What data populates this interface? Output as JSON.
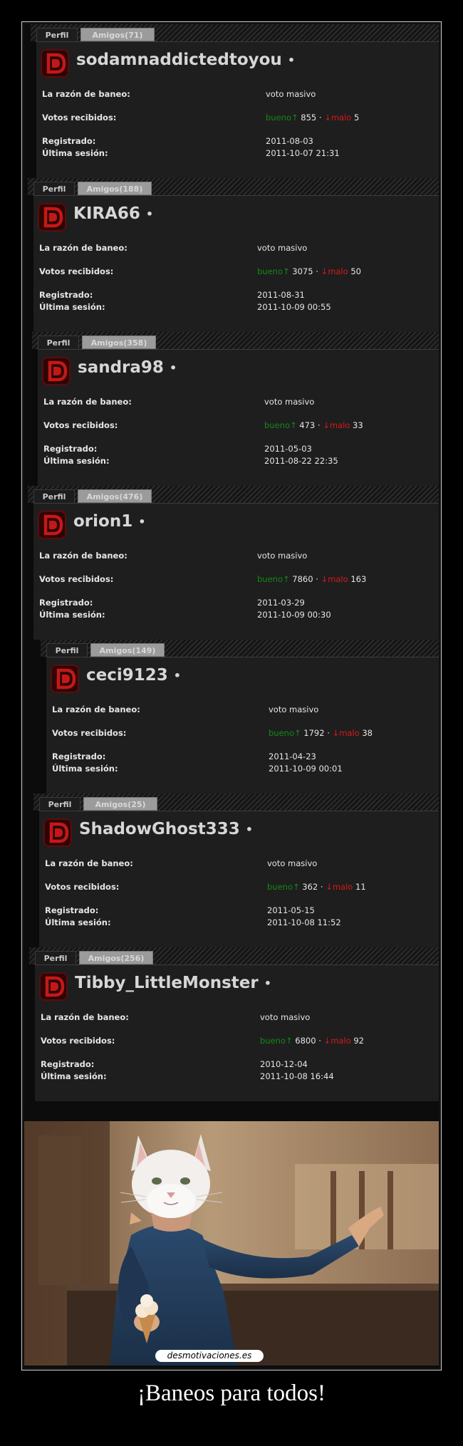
{
  "tabs": {
    "perfil": "Perfil"
  },
  "labels": {
    "reason": "La razón de baneo:",
    "votes": "Votos recibidos:",
    "registered": "Registrado:",
    "last_session": "Última sesión:"
  },
  "vote_words": {
    "good": "bueno",
    "bad": "malo"
  },
  "profiles": [
    {
      "username": "sodamnaddictedtoyou",
      "friends_tab": "Amigos(71)",
      "reason": "voto masivo",
      "good_votes": "855",
      "bad_votes": "5",
      "registered": "2011-08-03",
      "last_session": "2011-10-07 21:31"
    },
    {
      "username": "KIRA66",
      "friends_tab": "Amigos(188)",
      "reason": "voto masivo",
      "good_votes": "3075",
      "bad_votes": "50",
      "registered": "2011-08-31",
      "last_session": "2011-10-09 00:55"
    },
    {
      "username": "sandra98",
      "friends_tab": "Amigos(358)",
      "reason": "voto masivo",
      "good_votes": "473",
      "bad_votes": "33",
      "registered": "2011-05-03",
      "last_session": "2011-08-22 22:35"
    },
    {
      "username": "orion1",
      "friends_tab": "Amigos(476)",
      "reason": "voto masivo",
      "good_votes": "7860",
      "bad_votes": "163",
      "registered": "2011-03-29",
      "last_session": "2011-10-09 00:30"
    },
    {
      "username": "ceci9123",
      "friends_tab": "Amigos(149)",
      "reason": "voto masivo",
      "good_votes": "1792",
      "bad_votes": "38",
      "registered": "2011-04-23",
      "last_session": "2011-10-09 00:01"
    },
    {
      "username": "ShadowGhost333",
      "friends_tab": "Amigos(25)",
      "reason": "voto masivo",
      "good_votes": "362",
      "bad_votes": "11",
      "registered": "2011-05-15",
      "last_session": "2011-10-08 11:52"
    },
    {
      "username": "Tibby_LittleMonster",
      "friends_tab": "Amigos(256)",
      "reason": "voto masivo",
      "good_votes": "6800",
      "bad_votes": "92",
      "registered": "2010-12-04",
      "last_session": "2011-10-08 16:44"
    }
  ],
  "image": {
    "subject": "cat-headed man sitting on a bench holding an ice cream cone"
  },
  "watermark": "desmotivaciones.es",
  "caption": "¡Baneos para todos!",
  "colors": {
    "good": "#138a13",
    "bad": "#d81818",
    "logo": "#b71414"
  }
}
